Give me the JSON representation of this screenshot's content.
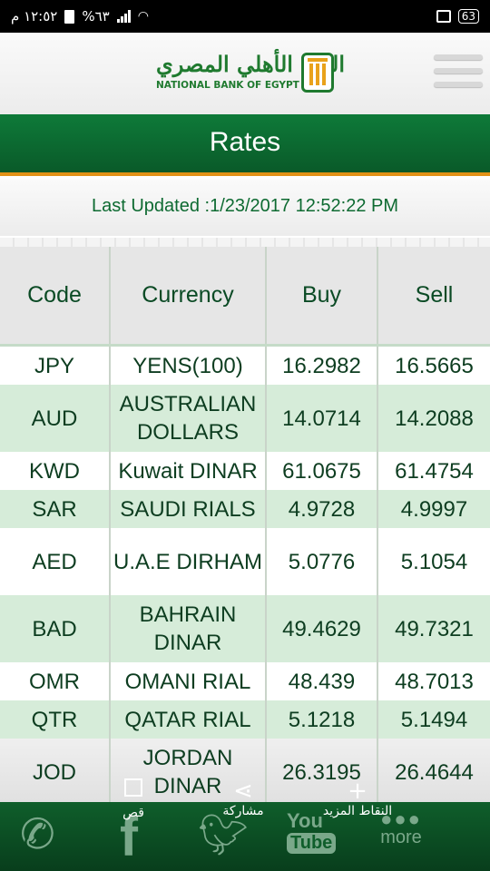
{
  "status_bar": {
    "time": "١٢:٥٢ م",
    "battery_percent": "%٦٣",
    "notification_count": "63",
    "icons": [
      "battery-icon",
      "signal-icon",
      "wifi-icon",
      "gallery-icon",
      "notification-badge-icon"
    ]
  },
  "header": {
    "logo_arabic": "البنك الأهلي المصري",
    "logo_english": "NATIONAL BANK OF EGYPT",
    "menu_icon": "hamburger-menu-icon"
  },
  "title": "Rates",
  "last_updated": "Last Updated :1/23/2017 12:52:22 PM",
  "table": {
    "headers": {
      "code": "Code",
      "currency": "Currency",
      "buy": "Buy",
      "sell": "Sell"
    },
    "rows": [
      {
        "code": "JPY",
        "currency": "YENS(100)",
        "buy": "16.2982",
        "sell": "16.5665"
      },
      {
        "code": "AUD",
        "currency": "AUSTRALIAN DOLLARS",
        "buy": "14.0714",
        "sell": "14.2088"
      },
      {
        "code": "KWD",
        "currency": "Kuwait DINAR",
        "buy": "61.0675",
        "sell": "61.4754"
      },
      {
        "code": "SAR",
        "currency": "SAUDI RIALS",
        "buy": "4.9728",
        "sell": "4.9997"
      },
      {
        "code": "AED",
        "currency": "U.A.E DIRHAM",
        "buy": "5.0776",
        "sell": "5.1054"
      },
      {
        "code": "BAD",
        "currency": "BAHRAIN DINAR",
        "buy": "49.4629",
        "sell": "49.7321"
      },
      {
        "code": "OMR",
        "currency": "OMANI RIAL",
        "buy": "48.439",
        "sell": "48.7013"
      },
      {
        "code": "QTR",
        "currency": "QATAR RIAL",
        "buy": "5.1218",
        "sell": "5.1494"
      },
      {
        "code": "JOD",
        "currency": "JORDAN DINAR",
        "buy": "26.3195",
        "sell": "26.4644"
      }
    ]
  },
  "bottom_bar": {
    "items": [
      {
        "icon": "phone-icon"
      },
      {
        "icon": "facebook-icon",
        "glyph": "f"
      },
      {
        "icon": "twitter-icon"
      },
      {
        "icon": "youtube-icon",
        "you": "You",
        "tube": "Tube"
      },
      {
        "icon": "more-icon",
        "label": "more"
      }
    ]
  },
  "overlay_actions": {
    "crop": "قص",
    "share": "مشاركة",
    "more_points": "النقاط المزيد"
  },
  "colors": {
    "brand_green": "#0e7a39",
    "accent_orange": "#e39218",
    "row_green": "#d6ecd9",
    "text_green": "#0d6a31"
  }
}
